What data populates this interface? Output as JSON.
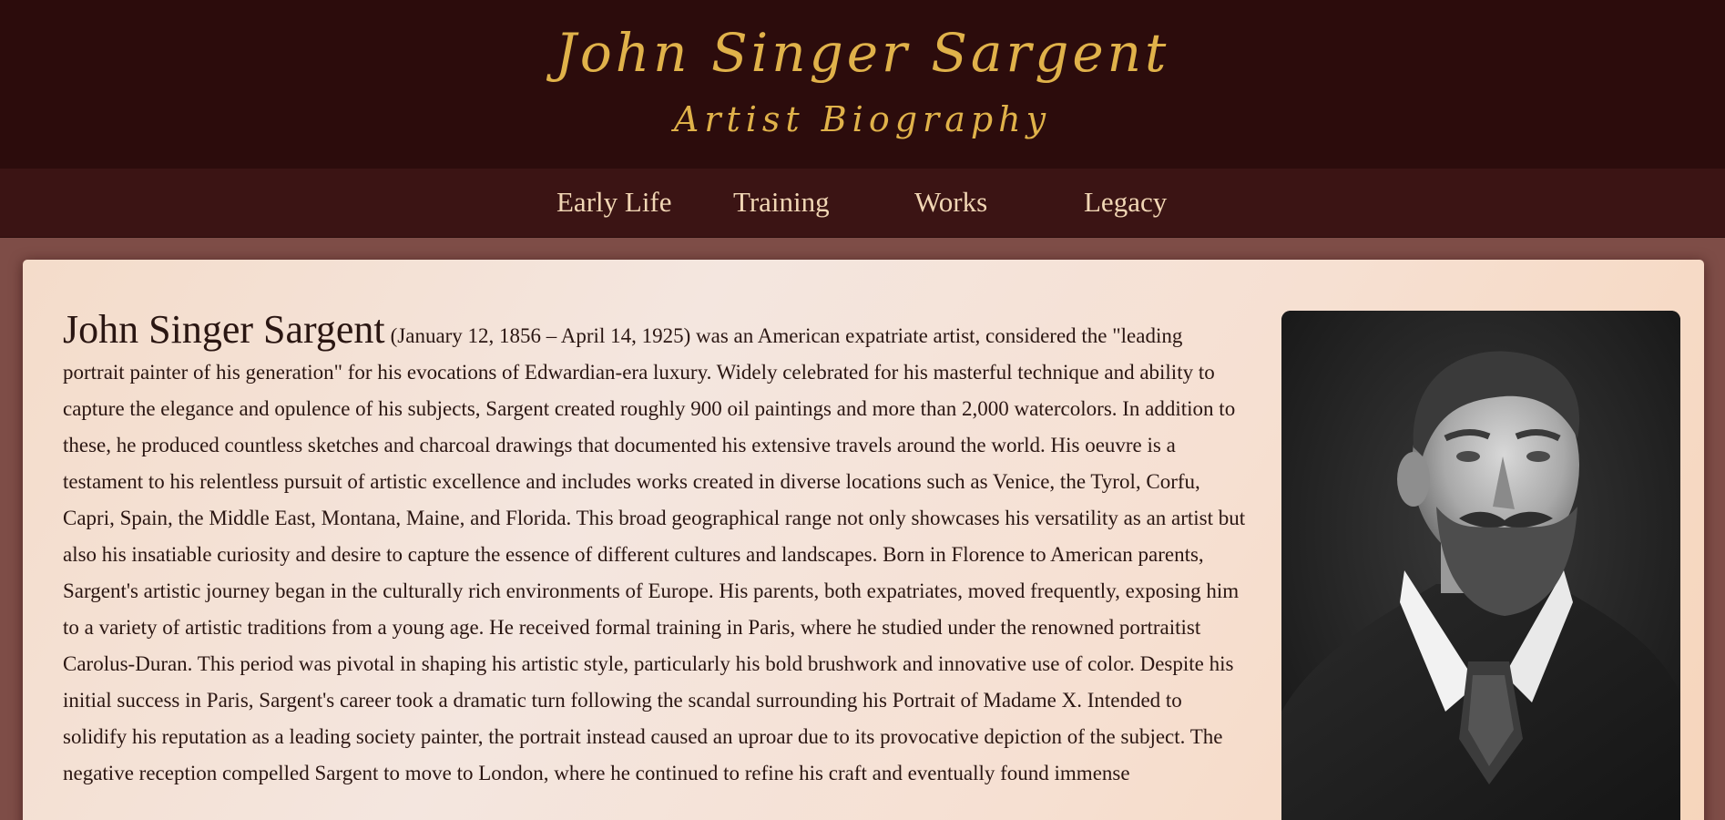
{
  "header": {
    "title": "John Singer Sargent",
    "subtitle": "Artist Biography"
  },
  "nav": {
    "items": [
      {
        "label": "Early Life"
      },
      {
        "label": "Training"
      },
      {
        "label": "Works"
      },
      {
        "label": "Legacy"
      }
    ]
  },
  "bio": {
    "name": "John Singer Sargent",
    "body": "(January 12, 1856 – April 14, 1925) was an American expatriate artist, considered the \"leading portrait painter of his generation\" for his evocations of Edwardian-era luxury. Widely celebrated for his masterful technique and ability to capture the elegance and opulence of his subjects, Sargent created roughly 900 oil paintings and more than 2,000 watercolors. In addition to these, he produced countless sketches and charcoal drawings that documented his extensive travels around the world. His oeuvre is a testament to his relentless pursuit of artistic excellence and includes works created in diverse locations such as Venice, the Tyrol, Corfu, Capri, Spain, the Middle East, Montana, Maine, and Florida. This broad geographical range not only showcases his versatility as an artist but also his insatiable curiosity and desire to capture the essence of different cultures and landscapes. Born in Florence to American parents, Sargent's artistic journey began in the culturally rich environments of Europe. His parents, both expatriates, moved frequently, exposing him to a variety of artistic traditions from a young age. He received formal training in Paris, where he studied under the renowned portraitist Carolus-Duran. This period was pivotal in shaping his artistic style, particularly his bold brushwork and innovative use of color. Despite his initial success in Paris, Sargent's career took a dramatic turn following the scandal surrounding his Portrait of Madame X. Intended to solidify his reputation as a leading society painter, the portrait instead caused an uproar due to its provocative depiction of the subject. The negative reception compelled Sargent to move to London, where he continued to refine his craft and eventually found immense"
  },
  "colors": {
    "header_bg": "#2c0c0c",
    "nav_bg": "#3b1414",
    "accent_gold": "#e0b24a",
    "nav_text": "#f1d6b4",
    "page_bg": "#7e4d47"
  }
}
